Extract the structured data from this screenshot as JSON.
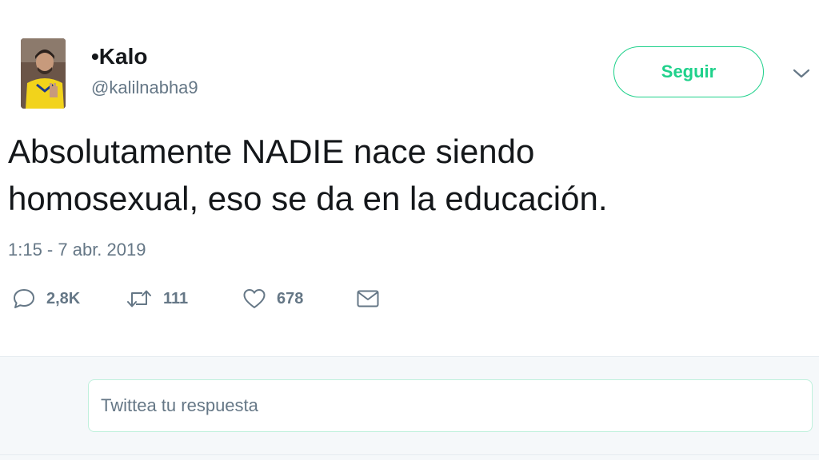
{
  "tweet": {
    "author": {
      "name": "•Kalo",
      "handle": "@kalilnabha9"
    },
    "follow_label": "Seguir",
    "text": "Absolutamente NADIE nace siendo\nhomosexual, eso se da en la educación.",
    "timestamp": "1:15 - 7 abr. 2019",
    "actions": {
      "reply_count": "2,8K",
      "retweet_count": "111",
      "like_count": "678"
    }
  },
  "reply": {
    "placeholder": "Twittea tu respuesta"
  },
  "colors": {
    "accent": "#1fd18b",
    "text_primary": "#14171a",
    "text_secondary": "#657786",
    "reply_background": "#f5f8fa"
  },
  "icons": {
    "reply": "speech-bubble-icon",
    "retweet": "retweet-icon",
    "like": "heart-icon",
    "message": "envelope-icon",
    "more": "chevron-down-icon"
  }
}
